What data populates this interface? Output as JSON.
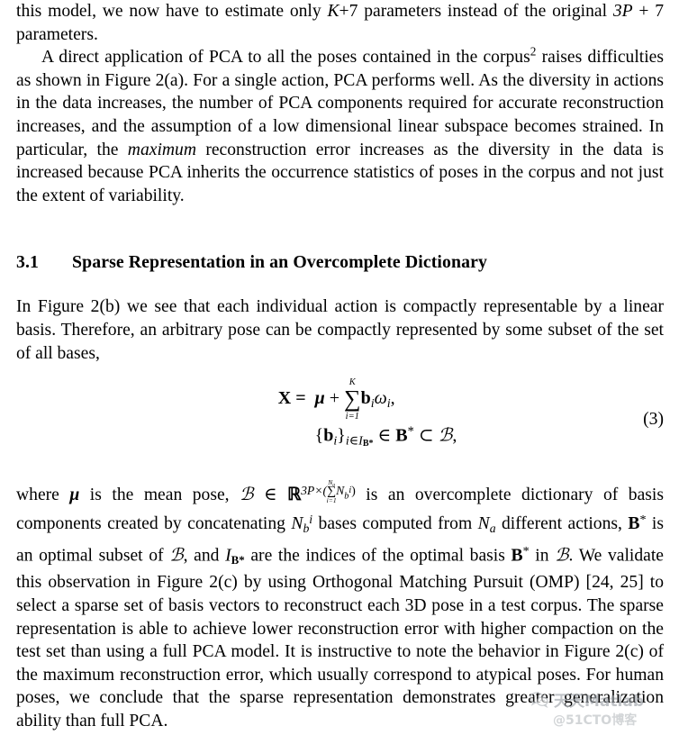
{
  "document": {
    "type": "academic-paper-page",
    "background_color": "#ffffff",
    "text_color": "#000000"
  },
  "paragraphs": {
    "p1_part1": "this model, we now have to estimate only ",
    "p1_math1": "K",
    "p1_plus1": "+7",
    "p1_part2": " parameters instead of the original ",
    "p1_math2": "3P",
    "p1_plus2": " + 7",
    "p1_part3": " parameters.",
    "p2_part1": "A direct application of PCA to all the poses contained in the corpus",
    "p2_footnote": "2",
    "p2_part2": " raises difficulties as shown in Figure 2(a). For a single action, PCA performs well. As the diversity in actions in the data increases, the number of PCA components required for accurate reconstruction increases, and the assumption of a low dimensional linear subspace becomes strained. In particular, the ",
    "p2_italic": "maximum",
    "p2_part3": " reconstruction error increases as the diversity in the data is increased because PCA inherits the occurrence statistics of poses in the corpus and not just the extent of variability.",
    "p3": "In Figure 2(b) we see that each individual action is compactly representable by a linear basis. Therefore, an arbitrary pose can be compactly represented by some subset of the set of all bases,",
    "p4_part1": "where ",
    "p4_mu": "μ",
    "p4_part2": " is the mean pose, ",
    "p4_B": "ℬ",
    "p4_part3": " ∈ ",
    "p4_R": "ℝ",
    "p4_exp_base": "3P×(",
    "p4_sum_top": "N",
    "p4_sum_top_sub": "a",
    "p4_sum_bot": "i=1",
    "p4_exp_N": "N",
    "p4_exp_N_sub": "b",
    "p4_exp_N_sup": "i",
    "p4_exp_close": ")",
    "p4_part4": " is an overcomplete dictionary of basis components created by concatenating ",
    "p4_Nbi": "N",
    "p4_Nbi_sub": "b",
    "p4_Nbi_sup": "i",
    "p4_part5": " bases computed from ",
    "p4_Na": "N",
    "p4_Na_sub": "a",
    "p4_part6": " different actions, ",
    "p4_Bstar": "B",
    "p4_Bstar_sup": "*",
    "p4_part7": " is an optimal subset of ",
    "p4_B2": "ℬ",
    "p4_part8": ", and ",
    "p4_I": "I",
    "p4_I_sub": "B*",
    "p4_part9": " are the indices of the optimal basis ",
    "p4_Bstar2": "B",
    "p4_Bstar2_sup": "*",
    "p4_part10": " in ",
    "p4_B3": "ℬ",
    "p4_part11": ". We validate this observation in Figure 2(c) by using Orthogonal Matching Pursuit (OMP) [24, 25] to select a sparse set of basis vectors to reconstruct each 3D pose in a test corpus. The sparse representation is able to achieve lower reconstruction error with higher compaction on the test set than using a full PCA model. It is instructive to note the behavior in Figure 2(c) of the maximum reconstruction error, which usually correspond to atypical poses. For human poses, we conclude that the sparse representation demonstrates greater generalization ability than full PCA."
  },
  "section": {
    "number": "3.1",
    "title": "Sparse Representation in an Overcomplete Dictionary"
  },
  "equation": {
    "number": "(3)",
    "lhs": "X =",
    "rhs_line1_mu": "μ",
    "rhs_line1_plus": " + ",
    "rhs_line1_sum": "∑",
    "rhs_line1_sum_top": "K",
    "rhs_line1_sum_bot": "i=1",
    "rhs_line1_b": "b",
    "rhs_line1_b_sub": "i",
    "rhs_line1_omega": "ω",
    "rhs_line1_omega_sub": "i",
    "rhs_line1_comma": ",",
    "rhs_line2_open": "{",
    "rhs_line2_b": "b",
    "rhs_line2_b_sub": "i",
    "rhs_line2_close": "}",
    "rhs_line2_setsub_i": "i∈",
    "rhs_line2_setsub_I": "I",
    "rhs_line2_setsub_Bstar": "B*",
    "rhs_line2_in": " ∈ ",
    "rhs_line2_Bstar": "B",
    "rhs_line2_Bstar_sup": "*",
    "rhs_line2_subset": " ⊂ ",
    "rhs_line2_Bcal": "ℬ",
    "rhs_line2_comma": ","
  },
  "watermark": {
    "brand": "天天Matlab",
    "handle": "@51CTO博客",
    "icon": "wechat-icon",
    "color": "#9aa0a6"
  }
}
